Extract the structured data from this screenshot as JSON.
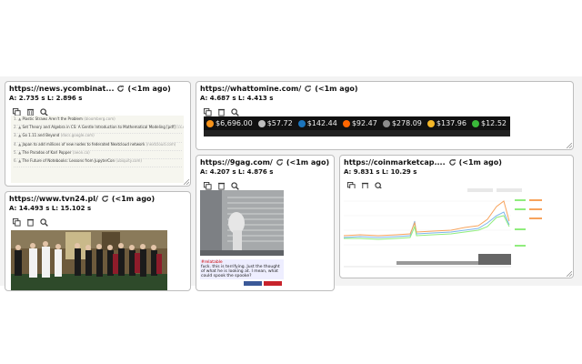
{
  "refresh_label": "(<1m ago)",
  "cards": {
    "hn": {
      "url": "https://news.ycombinat...",
      "stats": "A: 2.735 s L: 2.896 s",
      "items": [
        {
          "num": "1.",
          "title": "Plastic Straws Aren't the Problem",
          "site": "(bloomberg.com)"
        },
        {
          "num": "2.",
          "title": "Set Theory and Algebra in CS: A Gentle Introduction to Mathematical Modeling [pdf]",
          "site": "(cs.msu.edu)"
        },
        {
          "num": "3.",
          "title": "Go 1.11 and Beyond",
          "site": "(docs.google.com)"
        },
        {
          "num": "4.",
          "title": "Japan to add millions of new nodes to federated Nextcloud network",
          "site": "(nextcloud.com)"
        },
        {
          "num": "5.",
          "title": "The Paradox of Karl Popper",
          "site": "(aeon.co)"
        },
        {
          "num": "6.",
          "title": "The Future of Notebooks: Lessons from JupyterCon",
          "site": "(ubiquity.com)"
        }
      ]
    },
    "whattomine": {
      "url": "https://whattomine.com/",
      "stats": "A: 4.687 s L: 4.413 s",
      "prices": [
        {
          "glyph": "₿",
          "color": "#f7931a",
          "price": "$6,696.00"
        },
        {
          "glyph": "Ł",
          "color": "#bfbfbf",
          "price": "$57.72"
        },
        {
          "glyph": "D",
          "color": "#1c75bc",
          "price": "$142.44"
        },
        {
          "glyph": "M",
          "color": "#ff6600",
          "price": "$92.47"
        },
        {
          "glyph": "⧫",
          "color": "#8c8c8c",
          "price": "$278.09"
        },
        {
          "glyph": "Z",
          "color": "#f4b728",
          "price": "$137.96"
        },
        {
          "glyph": "E",
          "color": "#3ab83a",
          "price": "$12.52"
        }
      ]
    },
    "tvn24": {
      "url": "https://www.tvn24.pl/",
      "stats": "A: 14.493 s L: 15.102 s"
    },
    "ninegag": {
      "url": "https://9gag.com/",
      "stats": "A: 4.207 s L: 4.876 s",
      "tag": "#relatable",
      "caption": "fuck. this is terrifying. Just the thought of what he is looking at. I mean, what could spook the spooke?"
    },
    "cmc": {
      "url": "https://coinmarketcap....",
      "stats": "A: 9.831 s L: 10.29 s"
    }
  }
}
